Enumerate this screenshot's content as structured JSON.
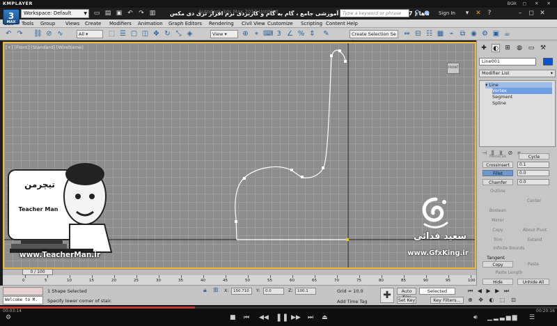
{
  "player": {
    "name": "KMPLAYER",
    "box_label": "BOX",
    "window_controls": "– ◻ ✕ ✕",
    "time_current": "00:03:14",
    "time_total": "00:20:16",
    "progress_fraction": 0.35
  },
  "app": {
    "icon_label": "3",
    "icon_sub": "MAX",
    "workspace": "Workspace: Default",
    "window_title": "مجموعه آموزشی جامع ، گام به گام و کاربردی نرم افزار تری دی مکس ( 3ds max 2017 )   مدرس : سعید فدائی ( تیچرمن ) گروه آموزشی پادشاه گرافیست ها",
    "bg_title": "Autodesk 3ds Max 2017    Untitled",
    "search_placeholder": "Type a keyword or phrase",
    "sign_in": "Sign In"
  },
  "menu": [
    "Edit",
    "Tools",
    "Group",
    "Views",
    "Create",
    "Modifiers",
    "Animation",
    "Graph Editors",
    "Rendering",
    "Civil View",
    "Customize",
    "Scripting",
    "Content",
    "Help"
  ],
  "toolbar": {
    "filter": "All",
    "view": "View",
    "selection_set": "Create Selection Se"
  },
  "viewport": {
    "label": "[+] [Front] [Standard] [Wireframe]",
    "viewcube": "FRONT"
  },
  "watermark": {
    "left_brand_fa": "تیچرمن",
    "left_brand_en": "Teacher Man",
    "left_url": "www.TeacherMan.ir",
    "right_name": "سعید فدائی",
    "right_url": "www.GfxKing.ir"
  },
  "command_panel": {
    "object_name": "Line001",
    "object_color": "#0a52d6",
    "modifier_list": "Modifier List",
    "stack": [
      "Line",
      "Vertex",
      "Segment",
      "Spline"
    ],
    "reverse": "Reverse",
    "cycle": "Cycle",
    "crossinsert": "CrossInsert",
    "crossinsert_val": "0.1",
    "fillet": "Fillet",
    "fillet_val": "0.0",
    "chamfer": "Chamfer",
    "chamfer_val": "0.0",
    "outline": "Outline",
    "center": "Center",
    "boolean": "Boolean",
    "mirror": "Mirror",
    "copy": "Copy",
    "about_pivot": "About Pivot",
    "trim": "Trim",
    "extend": "Extend",
    "infinite_bounds": "Infinite Bounds",
    "tangent": "Tangent",
    "tangent_copy": "Copy",
    "tangent_paste": "Paste",
    "paste_length": "Paste Length",
    "hide": "Hide",
    "unhide_all": "Unhide All"
  },
  "timeline": {
    "slider": "0 / 100",
    "ticks": [
      0,
      5,
      10,
      15,
      20,
      25,
      30,
      35,
      40,
      45,
      50,
      55,
      60,
      65,
      70,
      75,
      80,
      85,
      90,
      95,
      100
    ]
  },
  "status": {
    "maxscript": "Welcome to M.",
    "selection": "1 Shape Selected",
    "prompt": "Specify lower corner of stair.",
    "x_label": "X:",
    "x_val": "150.710",
    "y_label": "Y:",
    "y_val": "0.0",
    "z_label": "Z:",
    "z_val": "100.1",
    "grid": "Grid = 10.0",
    "add_time_tag": "Add Time Tag",
    "auto_key": "Auto Key",
    "selected": "Selected",
    "set_key": "Set Key",
    "key_filters": "Key Filters..."
  }
}
